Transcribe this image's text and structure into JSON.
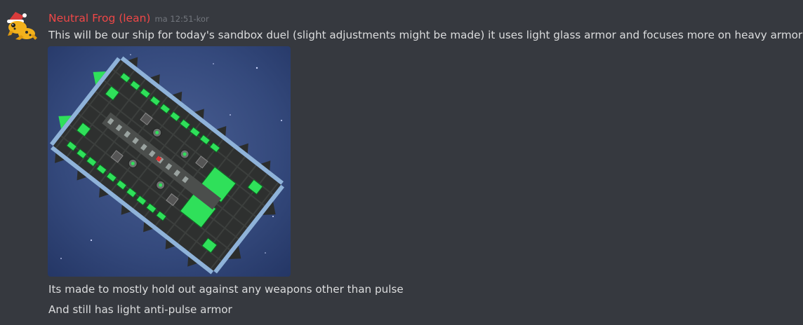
{
  "message": {
    "author": "Neutral Frog (lean)",
    "timestamp": "ma 12:51-kor",
    "content_lines": [
      "This will be our ship for today's sandbox duel (slight adjustments might be made) it uses light glass armor and focuses more on heavy armor",
      "Its made to mostly hold out against any weapons other than pulse",
      "And still has light anti-pulse armor"
    ],
    "avatar_icon": "frog-santa-hat-icon",
    "attachment_icon": "spaceship-image"
  },
  "colors": {
    "background": "#36393f",
    "username": "#f04747",
    "timestamp": "#72767d",
    "text": "#dcddde"
  }
}
